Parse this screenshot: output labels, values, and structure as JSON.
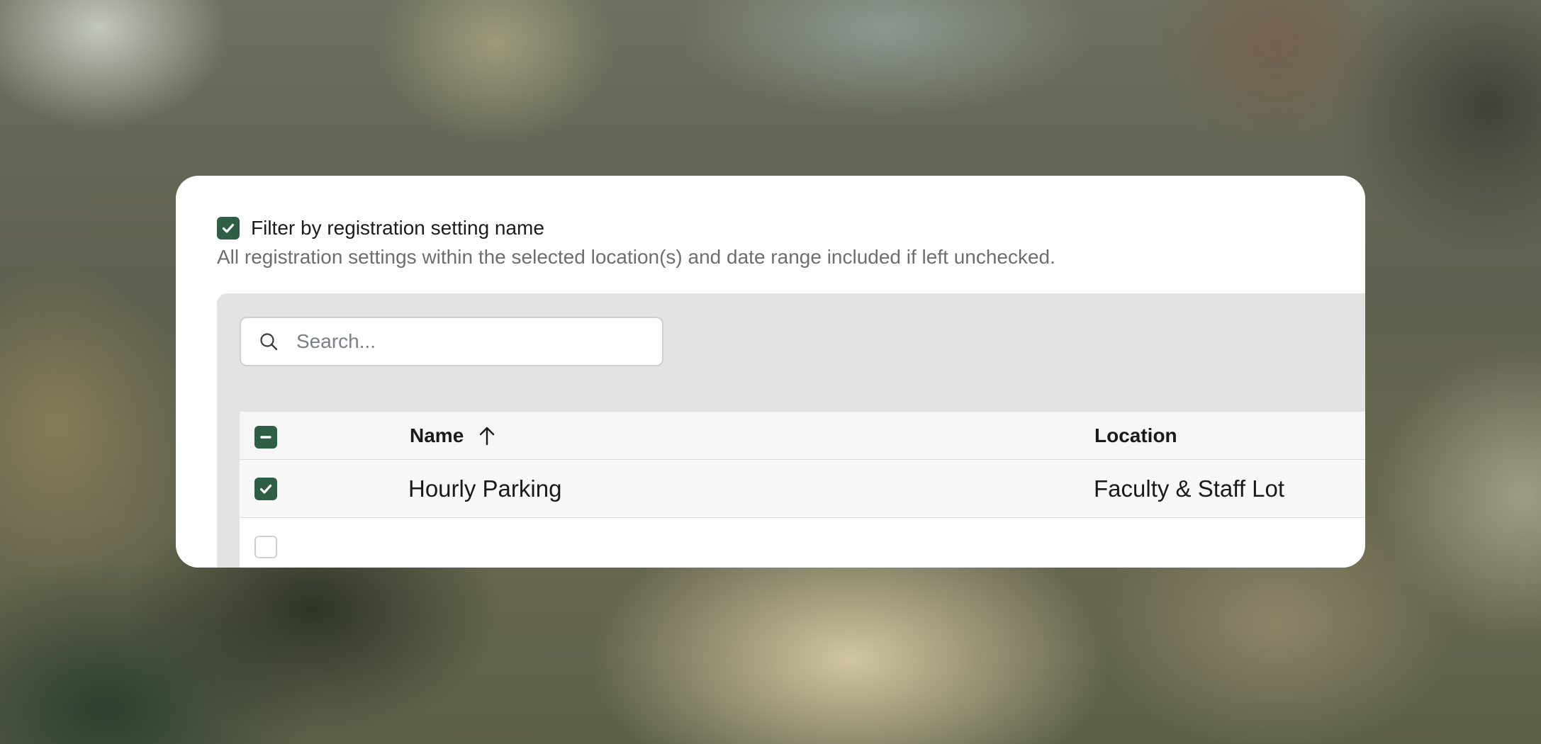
{
  "filter": {
    "label": "Filter by registration setting name",
    "checked": true,
    "hint": "All registration settings within the selected location(s) and date range included if left unchecked."
  },
  "search": {
    "placeholder": "Search...",
    "value": "",
    "icon": "search-icon"
  },
  "table": {
    "select_all_state": "indeterminate",
    "columns": {
      "name": "Name",
      "name_sort": "ascending",
      "location": "Location"
    },
    "rows": [
      {
        "checked": true,
        "name": "Hourly Parking",
        "location": "Faculty & Staff Lot"
      },
      {
        "checked": false,
        "name": "",
        "location": ""
      }
    ]
  },
  "colors": {
    "accent": "#2e5e43",
    "panel": "#e3e3e3",
    "hint_text": "#6e6e6e"
  }
}
